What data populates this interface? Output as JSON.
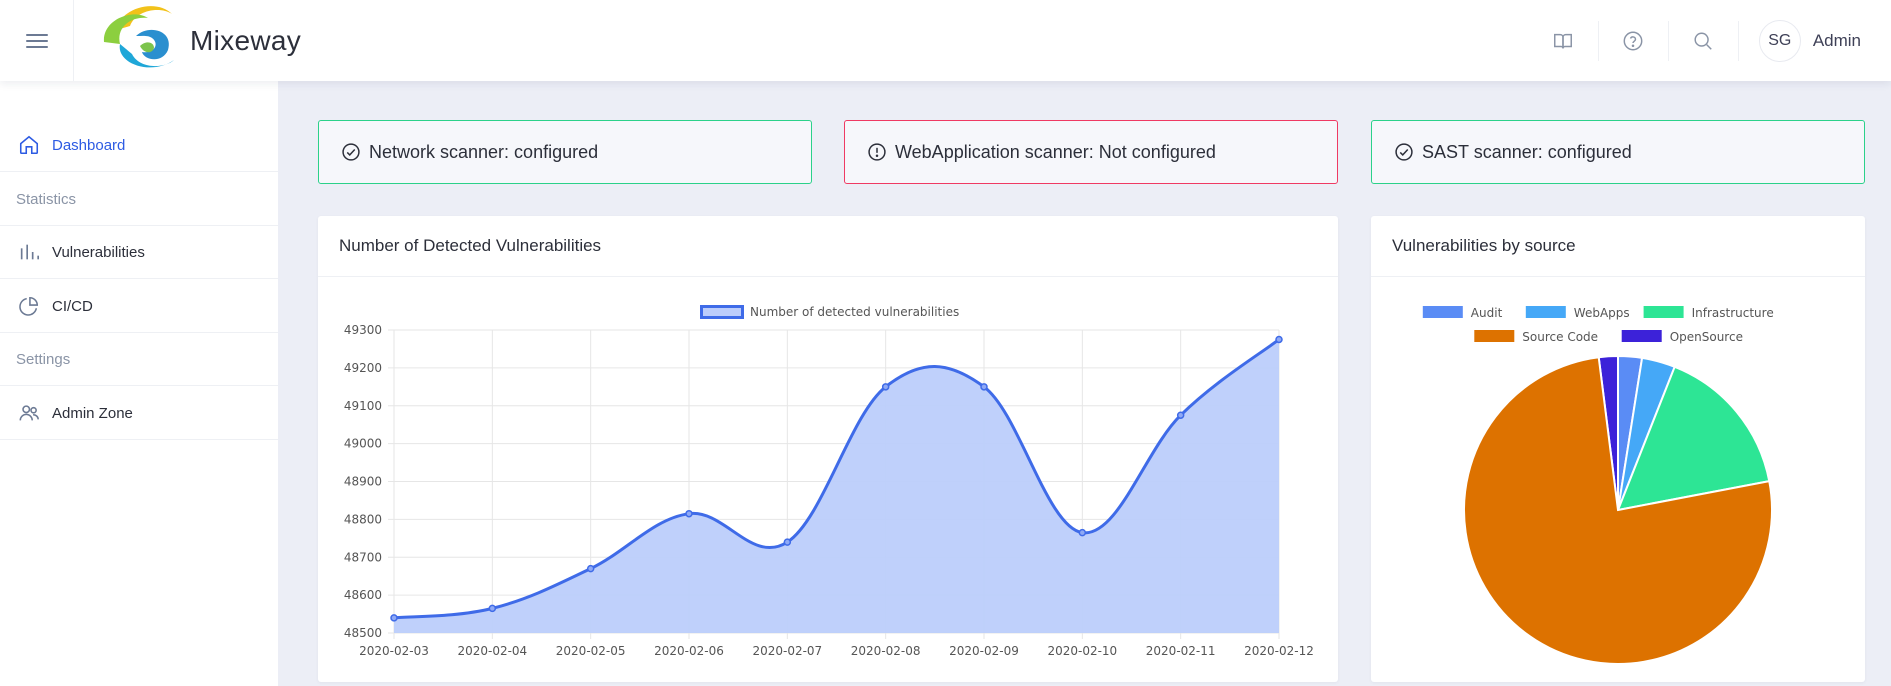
{
  "app": {
    "name": "Mixeway"
  },
  "header": {
    "icons": [
      "book-icon",
      "help-icon",
      "search-icon"
    ],
    "user": {
      "initials": "SG",
      "name": "Admin"
    }
  },
  "sidebar": {
    "items": [
      {
        "label": "Dashboard",
        "type": "link",
        "active": true,
        "icon": "home-icon"
      },
      {
        "label": "Statistics",
        "type": "heading"
      },
      {
        "label": "Vulnerabilities",
        "type": "link",
        "icon": "bar-chart-icon"
      },
      {
        "label": "CI/CD",
        "type": "link",
        "icon": "pie-chart-icon"
      },
      {
        "label": "Settings",
        "type": "heading"
      },
      {
        "label": "Admin Zone",
        "type": "link",
        "icon": "users-icon"
      }
    ]
  },
  "status_cards": [
    {
      "label": "Network scanner: configured",
      "state": "ok",
      "color": "#2bd18a"
    },
    {
      "label": "WebApplication scanner: Not configured",
      "state": "bad",
      "color": "#ef3a63"
    },
    {
      "label": "SAST scanner: configured",
      "state": "ok",
      "color": "#2bd18a"
    }
  ],
  "cards": {
    "line_title": "Number of Detected Vulnerabilities",
    "pie_title": "Vulnerabilities by source"
  },
  "colors": {
    "accent": "#2d5be3",
    "line": "#3f6be8",
    "fill": "#bccdfb"
  },
  "chart_data": [
    {
      "type": "area",
      "categories": [
        "2020-02-03",
        "2020-02-04",
        "2020-02-05",
        "2020-02-06",
        "2020-02-07",
        "2020-02-08",
        "2020-02-09",
        "2020-02-10",
        "2020-02-11",
        "2020-02-12"
      ],
      "series": [
        {
          "name": "Number of detected vulnerabilities",
          "values": [
            48540,
            48565,
            48670,
            48815,
            48740,
            49150,
            49150,
            48765,
            49075,
            49275
          ]
        }
      ],
      "ylim": [
        48500,
        49300
      ],
      "yticks": [
        48500,
        48600,
        48700,
        48800,
        48900,
        49000,
        49100,
        49200,
        49300
      ],
      "grid": true,
      "legend": "top-center"
    },
    {
      "type": "pie",
      "labels": [
        "Audit",
        "WebApps",
        "Infrastructure",
        "Source Code",
        "OpenSource"
      ],
      "values": [
        2.5,
        3.5,
        16,
        76,
        2
      ],
      "colors": [
        "#5a8cf5",
        "#45a8f7",
        "#2de595",
        "#dd7200",
        "#3c22d9"
      ],
      "legend": "top"
    }
  ]
}
